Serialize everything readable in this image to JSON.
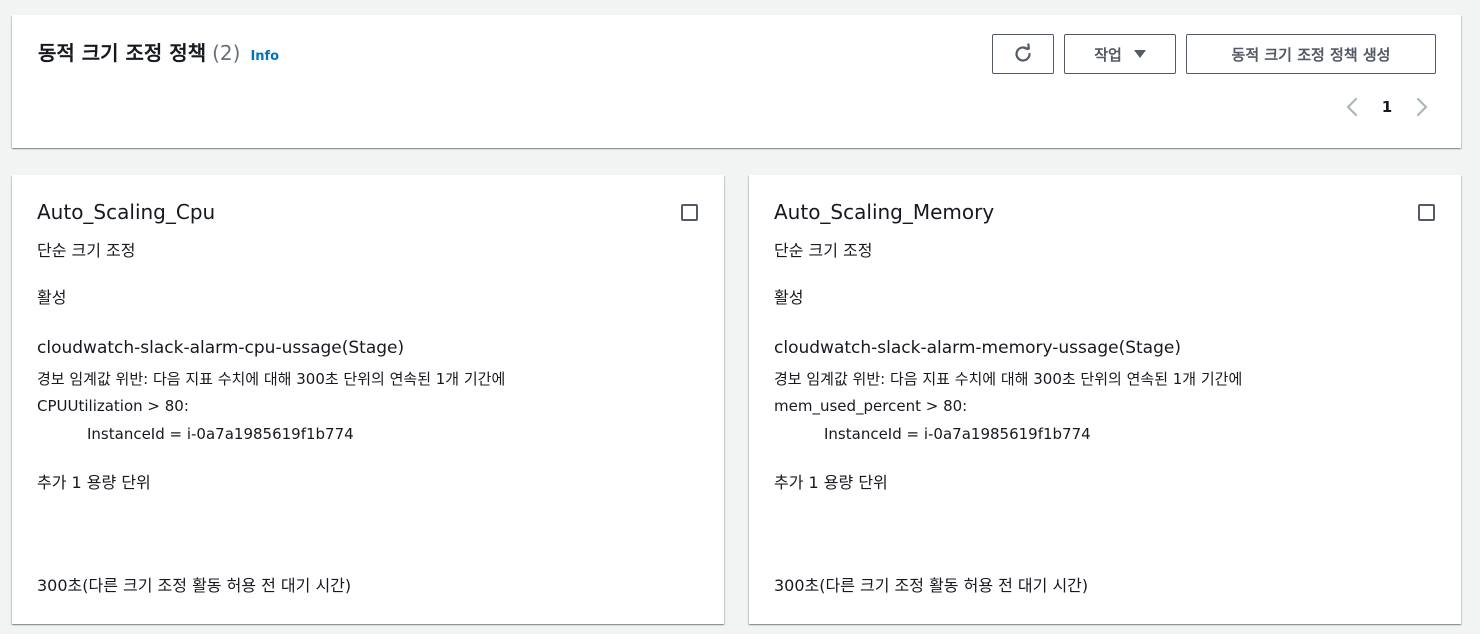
{
  "header": {
    "title": "동적 크기 조정 정책",
    "count": "(2)",
    "info": "Info",
    "actions_label": "작업",
    "create_label": "동적 크기 조정 정책 생성"
  },
  "pagination": {
    "current_page": "1"
  },
  "icons": {
    "refresh": "refresh-icon",
    "caret": "caret-down-icon",
    "prev": "chevron-left-icon",
    "next": "chevron-right-icon"
  },
  "colors": {
    "link": "#0073bb",
    "button_border": "#545b64",
    "page_bg": "#f2f3f3"
  },
  "policies": [
    {
      "name": "Auto_Scaling_Cpu",
      "type": "단순 크기 조정",
      "status": "활성",
      "alarm": "cloudwatch-slack-alarm-cpu-ussage(Stage)",
      "condition": "경보 임계값 위반: 다음 지표 수치에 대해 300초 단위의 연속된 1개 기간에",
      "metric": "CPUUtilization > 80:",
      "dimension": "InstanceId = i-0a7a1985619f1b774",
      "action": "추가 1 용량 단위",
      "cooldown": "300초(다른 크기 조정 활동 허용 전 대기 시간)"
    },
    {
      "name": "Auto_Scaling_Memory",
      "type": "단순 크기 조정",
      "status": "활성",
      "alarm": "cloudwatch-slack-alarm-memory-ussage(Stage)",
      "condition": "경보 임계값 위반: 다음 지표 수치에 대해 300초 단위의 연속된 1개 기간에",
      "metric": "mem_used_percent > 80:",
      "dimension": "InstanceId = i-0a7a1985619f1b774",
      "action": "추가 1 용량 단위",
      "cooldown": "300초(다른 크기 조정 활동 허용 전 대기 시간)"
    }
  ]
}
